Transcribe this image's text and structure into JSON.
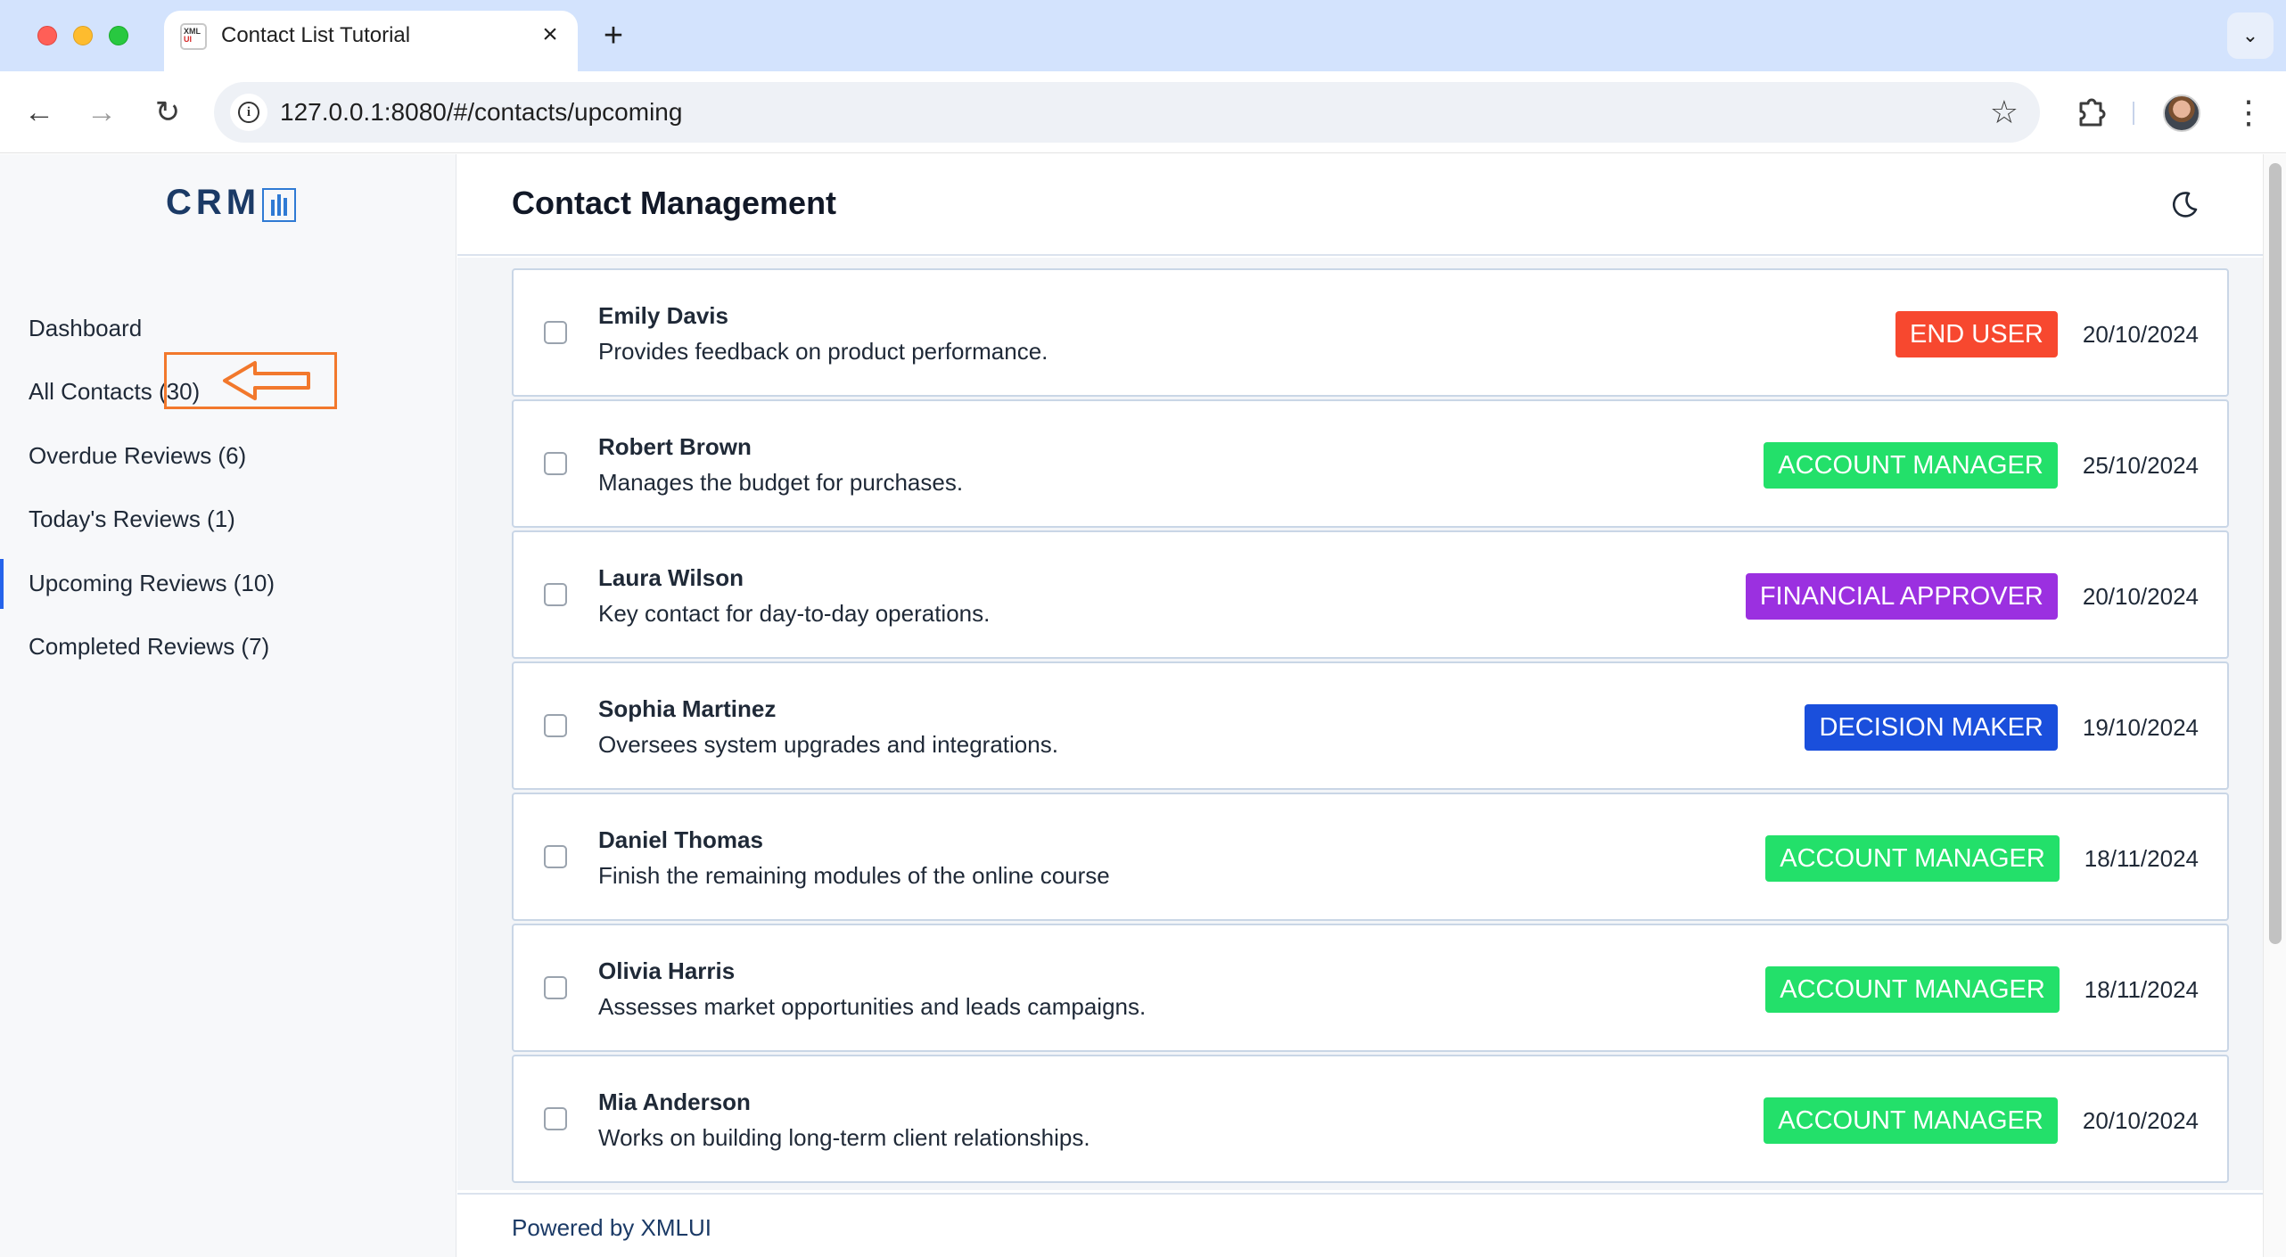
{
  "browser": {
    "tab_title": "Contact List Tutorial",
    "favicon_text_top": "XML",
    "favicon_text_bottom": "UI",
    "url": "127.0.0.1:8080/#/contacts/upcoming"
  },
  "sidebar": {
    "logo_text": "CRM",
    "items": [
      {
        "label": "Dashboard"
      },
      {
        "label": "All Contacts (30)"
      },
      {
        "label": "Overdue Reviews (6)"
      },
      {
        "label": "Today's Reviews (1)"
      },
      {
        "label": "Upcoming Reviews (10)"
      },
      {
        "label": "Completed Reviews (7)"
      }
    ],
    "active_index": 4
  },
  "header": {
    "title": "Contact Management"
  },
  "colors": {
    "end_user": "#f7482f",
    "account_manager": "#23e06a",
    "financial_approver": "#9b30e0",
    "decision_maker": "#1a4fdc",
    "annotation": "#f2782c"
  },
  "contacts": [
    {
      "name": "Emily Davis",
      "description": "Provides feedback on product performance.",
      "role": "END USER",
      "role_color": "#f7482f",
      "date": "20/10/2024"
    },
    {
      "name": "Robert Brown",
      "description": "Manages the budget for purchases.",
      "role": "ACCOUNT MANAGER",
      "role_color": "#23e06a",
      "date": "25/10/2024"
    },
    {
      "name": "Laura Wilson",
      "description": "Key contact for day-to-day operations.",
      "role": "FINANCIAL APPROVER",
      "role_color": "#9b30e0",
      "date": "20/10/2024"
    },
    {
      "name": "Sophia Martinez",
      "description": "Oversees system upgrades and integrations.",
      "role": "DECISION MAKER",
      "role_color": "#1a4fdc",
      "date": "19/10/2024"
    },
    {
      "name": "Daniel Thomas",
      "description": "Finish the remaining modules of the online course",
      "role": "ACCOUNT MANAGER",
      "role_color": "#23e06a",
      "date": "18/11/2024"
    },
    {
      "name": "Olivia Harris",
      "description": "Assesses market opportunities and leads campaigns.",
      "role": "ACCOUNT MANAGER",
      "role_color": "#23e06a",
      "date": "18/11/2024"
    },
    {
      "name": "Mia Anderson",
      "description": "Works on building long-term client relationships.",
      "role": "ACCOUNT MANAGER",
      "role_color": "#23e06a",
      "date": "20/10/2024"
    }
  ],
  "footer": {
    "text": "Powered by XMLUI"
  }
}
